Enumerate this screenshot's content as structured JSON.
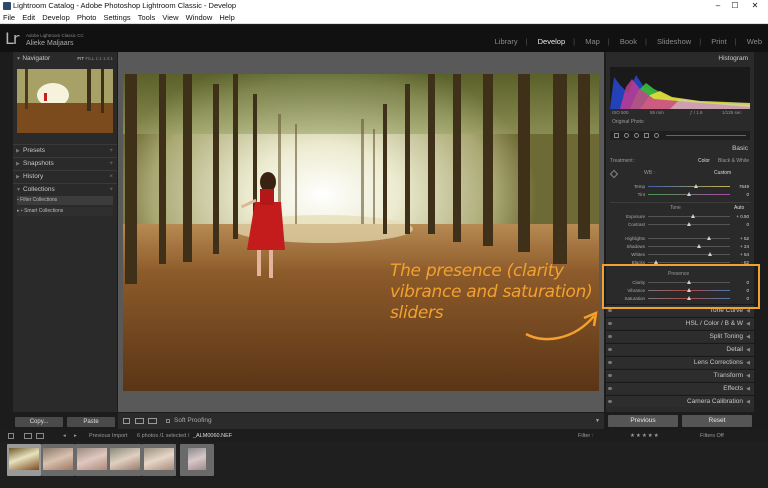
{
  "window": {
    "title": "Lightroom Catalog - Adobe Photoshop Lightroom Classic - Develop",
    "controls": [
      "–",
      "☐",
      "✕"
    ]
  },
  "menu": [
    "File",
    "Edit",
    "Develop",
    "Photo",
    "Settings",
    "Tools",
    "View",
    "Window",
    "Help"
  ],
  "identity": {
    "logo": "Lr",
    "product": "Adobe Lightroom Classic CC",
    "user": "Alieke Maljaars"
  },
  "modules": [
    "Library",
    "Develop",
    "Map",
    "Book",
    "Slideshow",
    "Print",
    "Web"
  ],
  "left_panel": {
    "navigator": "Navigator",
    "nav_zoom": [
      "FIT",
      "FILL",
      "1:1",
      "1:4:1"
    ],
    "presets": "Presets",
    "snapshots": "Snapshots",
    "history": "History",
    "collections": "Collections",
    "collection_items": [
      "Filter Collections",
      "Smart Collections"
    ],
    "copy_button": "Copy...",
    "paste_button": "Paste"
  },
  "toolbar": {
    "soft_proofing": "Soft Proofing"
  },
  "right_panel": {
    "histogram": "Histogram",
    "hist_meta": [
      "ISO 500",
      "55 mm",
      "ƒ / 1.8",
      "1/125 sec"
    ],
    "original_photo": "Original Photo",
    "basic": "Basic",
    "treatment_label": "Treatment :",
    "treatment_color": "Color",
    "treatment_bw": "Black & White",
    "wb_label": "WB :",
    "wb_value": "Custom",
    "tone_label": "Tone",
    "tone_auto": "Auto",
    "presence_label": "Presence",
    "sliders": [
      {
        "name": "Temp",
        "value": "7649",
        "pos": 0.58
      },
      {
        "name": "Tint",
        "value": "0",
        "pos": 0.5
      },
      {
        "name": "Exposure",
        "value": "+ 0.50",
        "pos": 0.55
      },
      {
        "name": "Contrast",
        "value": "0",
        "pos": 0.5
      },
      {
        "name": "Highlights",
        "value": "+ 52",
        "pos": 0.74
      },
      {
        "name": "Shadows",
        "value": "+ 24",
        "pos": 0.62
      },
      {
        "name": "Whites",
        "value": "+ 54",
        "pos": 0.76
      },
      {
        "name": "Blacks",
        "value": "- 82",
        "pos": 0.1
      },
      {
        "name": "Clarity",
        "value": "0",
        "pos": 0.5
      },
      {
        "name": "Vibrance",
        "value": "0",
        "pos": 0.5
      },
      {
        "name": "Saturation",
        "value": "0",
        "pos": 0.5
      }
    ],
    "sections": [
      "Tone Curve",
      "HSL / Color / B & W",
      "Split Toning",
      "Detail",
      "Lens Corrections",
      "Transform",
      "Effects",
      "Camera Calibration"
    ],
    "previous_button": "Previous",
    "reset_button": "Reset"
  },
  "filmstrip_bar": {
    "source": "Previous Import",
    "count": "6 photos /1 selected /",
    "filename": "_ALM0060.NEF",
    "filter_label": "Filter :",
    "filters_off": "Filters Off"
  },
  "filmstrip_count": 6,
  "annotation": {
    "line1": "The presence (clarity",
    "line2": "vibrance and saturation)",
    "line3": "sliders"
  },
  "colors": {
    "annotation": "#f2a12e",
    "panel": "#2a2a2a",
    "center": "#595959"
  }
}
